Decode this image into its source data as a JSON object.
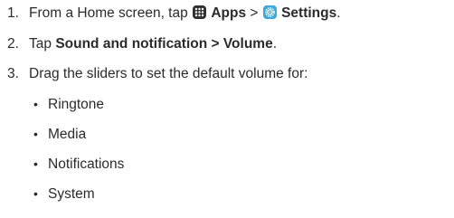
{
  "steps": [
    {
      "number": "1.",
      "text_a": "From a Home screen, tap ",
      "bold_a": "Apps",
      "sep": " > ",
      "bold_b": "Settings",
      "end": ".",
      "icon_a": "apps-grid-icon",
      "icon_b": "settings-gear-icon"
    },
    {
      "number": "2.",
      "text_a": "Tap ",
      "bold_a": "Sound and notification > Volume",
      "end": "."
    },
    {
      "number": "3.",
      "text_a": "Drag the sliders to set the default volume for:"
    }
  ],
  "bullets": {
    "symbol": "•",
    "items": [
      "Ringtone",
      "Media",
      "Notifications",
      "System"
    ]
  },
  "colors": {
    "text": "#2b2b2b",
    "apps_icon": "#2f2f2f",
    "settings_icon": "#3aa8d8"
  }
}
